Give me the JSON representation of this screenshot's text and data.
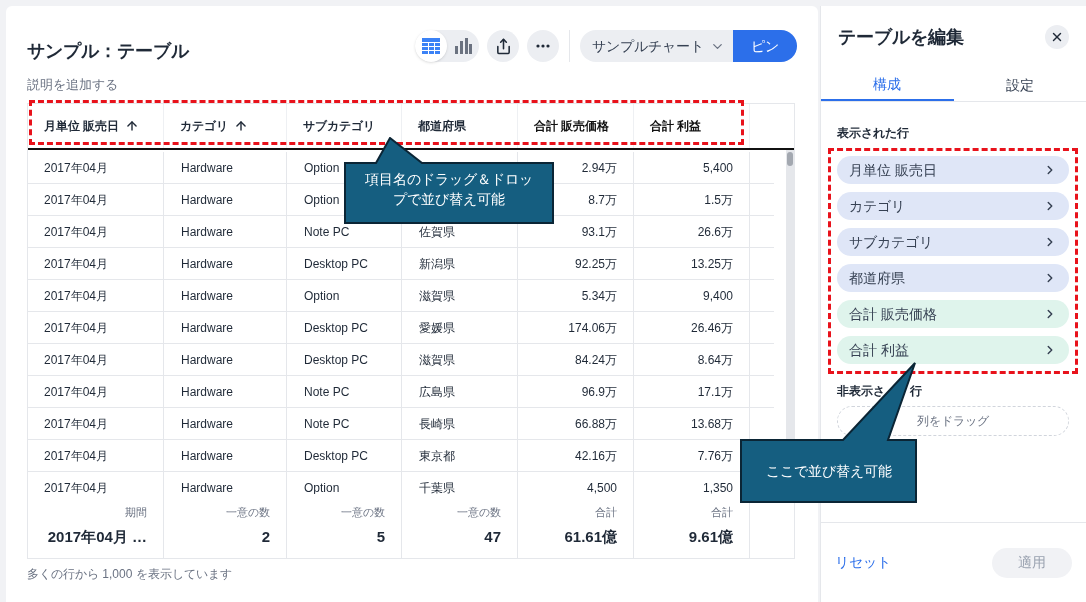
{
  "header": {
    "title": "サンプル：テーブル",
    "description": "説明を追加する"
  },
  "toolbar": {
    "view_toggle": [
      {
        "kind": "table",
        "selected": true
      },
      {
        "kind": "chart",
        "selected": false
      }
    ],
    "chart_select": "サンプルチャート",
    "pin_button": "ピン"
  },
  "table": {
    "columns": [
      {
        "label": "月単位 販売日",
        "sorted": true,
        "kind": "dimension"
      },
      {
        "label": "カテゴリ",
        "sorted": true,
        "kind": "dimension"
      },
      {
        "label": "サブカテゴリ",
        "sorted": false,
        "kind": "dimension"
      },
      {
        "label": "都道府県",
        "sorted": false,
        "kind": "dimension"
      },
      {
        "label": "合計 販売価格",
        "sorted": false,
        "kind": "measure"
      },
      {
        "label": "合計 利益",
        "sorted": false,
        "kind": "measure"
      }
    ],
    "rows": [
      [
        "2017年04月",
        "Hardware",
        "Option",
        null,
        "2.94万",
        "5,400"
      ],
      [
        "2017年04月",
        "Hardware",
        "Option",
        null,
        "8.7万",
        "1.5万"
      ],
      [
        "2017年04月",
        "Hardware",
        "Note PC",
        "佐賀県",
        "93.1万",
        "26.6万"
      ],
      [
        "2017年04月",
        "Hardware",
        "Desktop PC",
        "新潟県",
        "92.25万",
        "13.25万"
      ],
      [
        "2017年04月",
        "Hardware",
        "Option",
        "滋賀県",
        "5.34万",
        "9,400"
      ],
      [
        "2017年04月",
        "Hardware",
        "Desktop PC",
        "愛媛県",
        "174.06万",
        "26.46万"
      ],
      [
        "2017年04月",
        "Hardware",
        "Desktop PC",
        "滋賀県",
        "84.24万",
        "8.64万"
      ],
      [
        "2017年04月",
        "Hardware",
        "Note PC",
        "広島県",
        "96.9万",
        "17.1万"
      ],
      [
        "2017年04月",
        "Hardware",
        "Note PC",
        "長崎県",
        "66.88万",
        "13.68万"
      ],
      [
        "2017年04月",
        "Hardware",
        "Desktop PC",
        "東京都",
        "42.16万",
        "7.76万"
      ],
      [
        "2017年04月",
        "Hardware",
        "Option",
        "千葉県",
        "4,500",
        "1,350"
      ]
    ],
    "summary": [
      {
        "label": "期間",
        "value": "2017年04月 …"
      },
      {
        "label": "一意の数",
        "value": "2"
      },
      {
        "label": "一意の数",
        "value": "5"
      },
      {
        "label": "一意の数",
        "value": "47"
      },
      {
        "label": "合計",
        "value": "61.61億"
      },
      {
        "label": "合計",
        "value": "9.61億"
      }
    ]
  },
  "footer_note": "多くの行から 1,000 を表示しています",
  "panel": {
    "title": "テーブルを編集",
    "tabs": [
      {
        "label": "構成",
        "selected": true
      },
      {
        "label": "設定",
        "selected": false
      }
    ],
    "shown_heading": "表示された行",
    "shown_columns": [
      {
        "label": "月単位 販売日",
        "kind": "dimension"
      },
      {
        "label": "カテゴリ",
        "kind": "dimension"
      },
      {
        "label": "サブカテゴリ",
        "kind": "dimension"
      },
      {
        "label": "都道府県",
        "kind": "dimension"
      },
      {
        "label": "合計 販売価格",
        "kind": "measure"
      },
      {
        "label": "合計 利益",
        "kind": "measure"
      }
    ],
    "hidden_heading": [
      "非表示さ",
      "行"
    ],
    "drop_placeholder": "列をドラッグ",
    "reset": "リセット",
    "apply": {
      "label": "適用",
      "disabled": true
    }
  },
  "annotations": [
    {
      "text": "項目名のドラッグ＆ドロップで並び替え可能"
    },
    {
      "text": "ここで並び替え可能"
    }
  ]
}
